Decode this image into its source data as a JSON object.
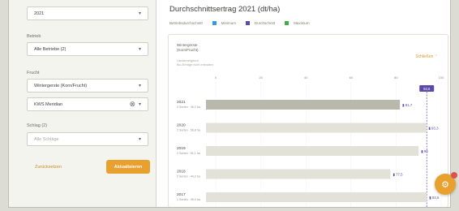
{
  "sidebar": {
    "year_select": {
      "value": "2021"
    },
    "farm": {
      "label": "Betrieb",
      "value": "Alle Betriebe (2)"
    },
    "crop": {
      "label": "Frucht",
      "value": "Wintergerste (Korn/Frucht)"
    },
    "crop_variety": {
      "value": "KWS Meridian"
    },
    "field": {
      "label": "Schlag (2)",
      "placeholder": "Alle Schläge"
    },
    "reset_label": "Zurücksetzen",
    "apply_label": "Aktualisieren"
  },
  "main": {
    "title": "Durchschnittsertrag 2021 (dt/ha)",
    "legend": {
      "caption": "Betriebsdurchschnitt",
      "items": [
        {
          "label": "Minimum",
          "color": "#3a9ad9"
        },
        {
          "label": "Durchschnitt",
          "color": "#5b4aa8"
        },
        {
          "label": "Maximum",
          "color": "#3fae49"
        }
      ]
    }
  },
  "card": {
    "subtitle_lines": [
      "Wintergerste",
      "(Korn/Frucht)"
    ],
    "note_lines": [
      "Ländervergleich",
      "Bio-Erträge nicht enthalten"
    ],
    "control_label": "Schließen ⌃"
  },
  "chart_data": {
    "type": "bar",
    "orientation": "horizontal",
    "x_ticks": [
      0,
      20,
      40,
      60,
      80,
      100
    ],
    "xlim": [
      0,
      100
    ],
    "reference": {
      "value": 93.6,
      "label": "93,6",
      "color": "#5b4aa8"
    },
    "categories": [
      "2021",
      "2020",
      "2019",
      "2018",
      "2017"
    ],
    "sublabels": [
      "2 Sorten · 46,2 ha",
      "2 Sorten · 58,8 ha",
      "2 Sorten · 51,1 ha",
      "2 Sorten · 44,2 ha",
      "2 Sorten · 49,0 ha"
    ],
    "values": [
      81.7,
      93.3,
      90.0,
      77.5,
      93.6
    ],
    "value_labels": [
      "81,7",
      "93,3",
      "90",
      "77,5",
      "93,6"
    ],
    "highlight_color": "#b8b8ad",
    "bar_color": "#e2e2d8",
    "value_label_color": "#5b4aa8"
  }
}
